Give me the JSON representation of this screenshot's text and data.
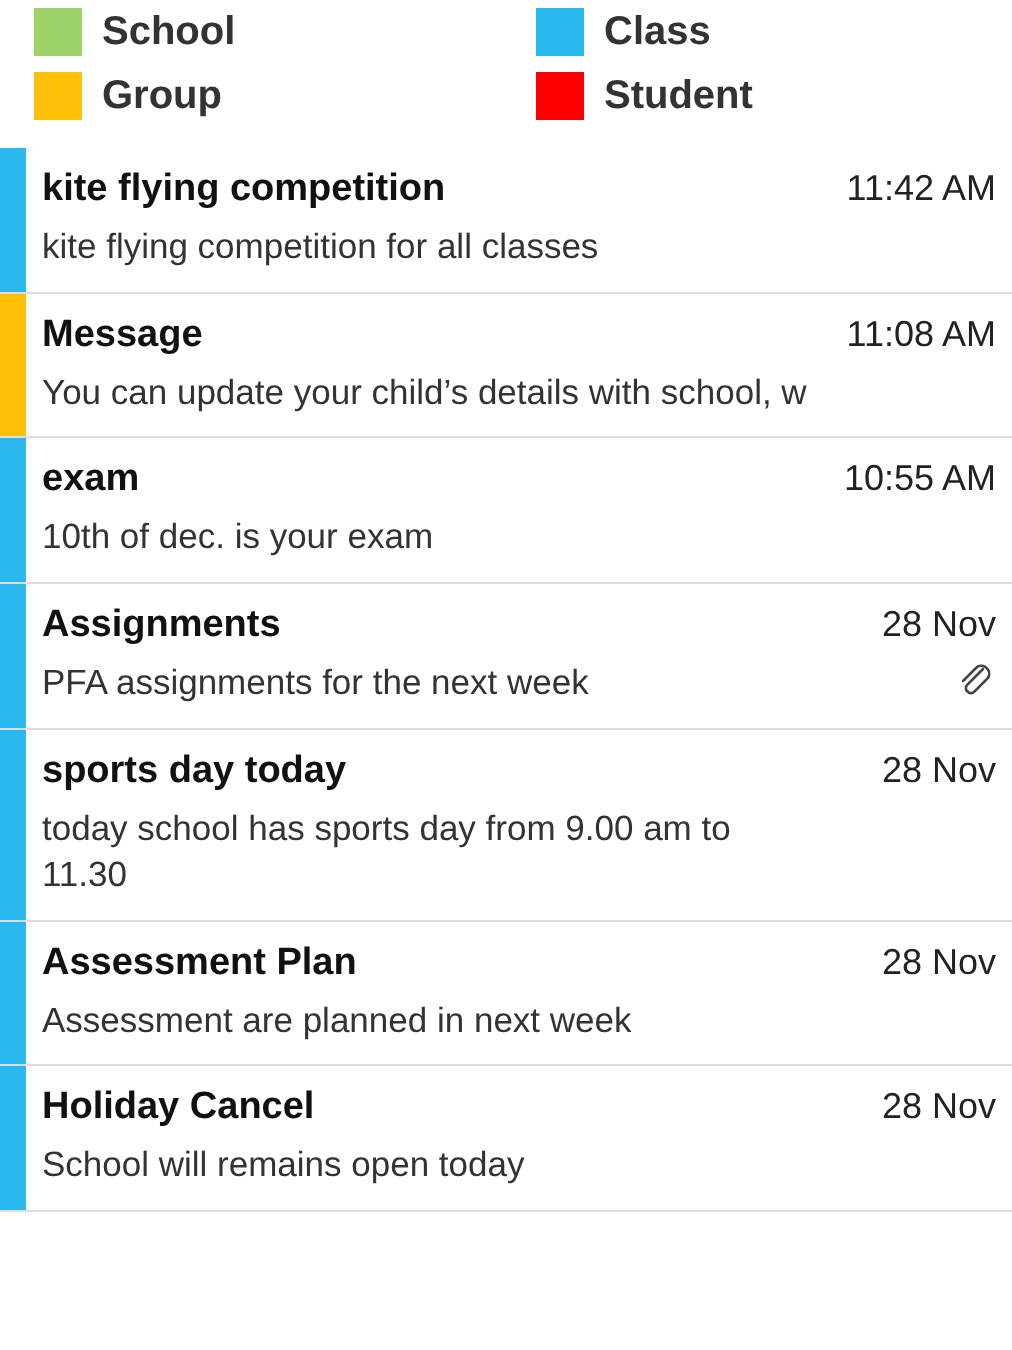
{
  "legend": [
    {
      "label": "School",
      "color": "#9ed36a"
    },
    {
      "label": "Class",
      "color": "#2bb8ee"
    },
    {
      "label": "Group",
      "color": "#ffc107"
    },
    {
      "label": "Student",
      "color": "#ff0000"
    }
  ],
  "messages": [
    {
      "title": "kite flying competition",
      "time": "11:42 AM",
      "body": "kite flying competition for all classes",
      "color": "#2bb8ee",
      "attachment": false
    },
    {
      "title": "Message",
      "time": "11:08 AM",
      "body": "You can update your child’s details with school, w",
      "color": "#ffc107",
      "attachment": false
    },
    {
      "title": "exam",
      "time": "10:55 AM",
      "body": "10th of dec. is your exam",
      "color": "#2bb8ee",
      "attachment": false
    },
    {
      "title": "Assignments",
      "time": "28 Nov",
      "body": "PFA assignments for the next week",
      "color": "#2bb8ee",
      "attachment": true
    },
    {
      "title": "sports day today",
      "time": "28 Nov",
      "body": "today school has sports day from 9.00 am to 11.30",
      "color": "#2bb8ee",
      "attachment": false
    },
    {
      "title": "Assessment Plan",
      "time": "28 Nov",
      "body": "Assessment are planned in next week",
      "color": "#2bb8ee",
      "attachment": false
    },
    {
      "title": "Holiday Cancel",
      "time": "28 Nov",
      "body": "School will remains open today",
      "color": "#2bb8ee",
      "attachment": false
    }
  ]
}
